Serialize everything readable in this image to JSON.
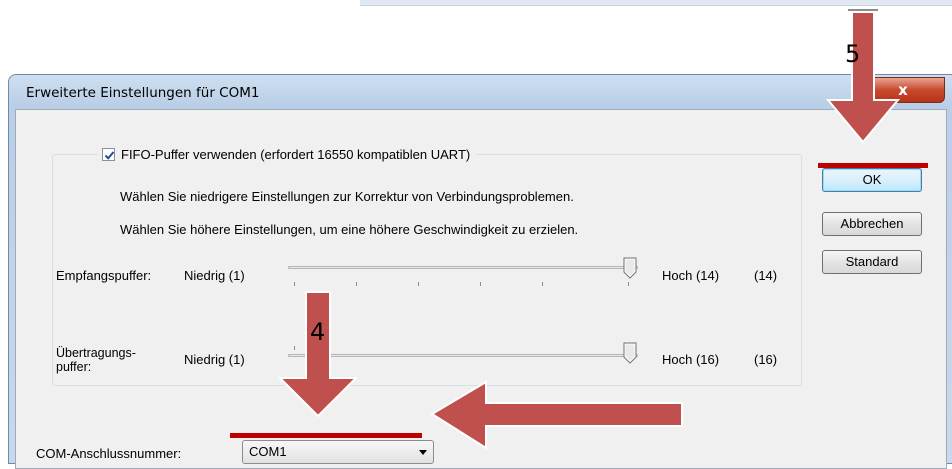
{
  "dialog": {
    "title": "Erweiterte Einstellungen für COM1",
    "close_glyph": "x"
  },
  "fifo": {
    "checked": true,
    "label": "FIFO-Puffer verwenden (erfordert 16550 kompatiblen UART)"
  },
  "info": {
    "line1": "Wählen Sie niedrigere Einstellungen zur Korrektur von Verbindungsproblemen.",
    "line2": "Wählen Sie höhere Einstellungen, um eine höhere Geschwindigkeit zu erzielen."
  },
  "receive_buffer": {
    "label": "Empfangspuffer:",
    "min_label": "Niedrig (1)",
    "max_label": "Hoch (14)",
    "value_label": "(14)",
    "value": 14,
    "max": 14
  },
  "transmit_buffer": {
    "label": "Übertragungs-\npuffer:",
    "label_line1": "Übertragungs-",
    "label_line2": "puffer:",
    "min_label": "Niedrig (1)",
    "max_label": "Hoch (16)",
    "value_label": "(16)",
    "value": 16,
    "max": 16
  },
  "com_port": {
    "label": "COM-Anschlussnummer:",
    "selected": "COM1"
  },
  "buttons": {
    "ok": "OK",
    "cancel": "Abbrechen",
    "default": "Standard"
  },
  "annotations": {
    "step4": "4",
    "step5": "5",
    "arrow_color": "#c0504d",
    "highlight_color": "#c00000"
  }
}
